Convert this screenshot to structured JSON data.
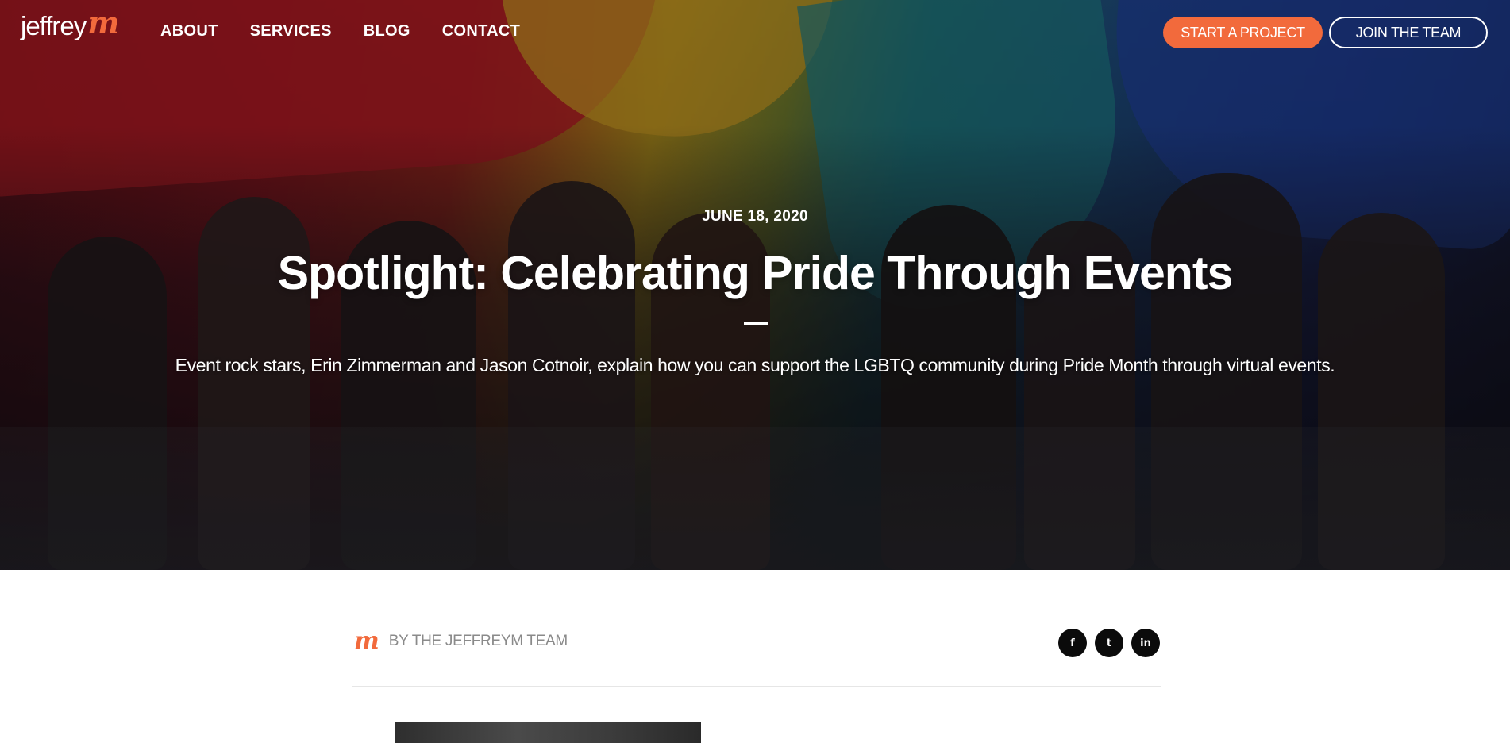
{
  "brand": {
    "logo_text": "jeffrey",
    "logo_mark": "m",
    "accent_color": "#f26a3c"
  },
  "nav": {
    "items": [
      {
        "label": "ABOUT"
      },
      {
        "label": "SERVICES"
      },
      {
        "label": "BLOG"
      },
      {
        "label": "CONTACT"
      }
    ],
    "start_project_label": "START A PROJECT",
    "join_team_label": "JOIN THE TEAM"
  },
  "hero": {
    "date": "JUNE 18, 2020",
    "title": "Spotlight: Celebrating Pride Through Events",
    "subtitle": "Event rock stars, Erin Zimmerman and Jason Cotnoir, explain how you can support the LGBTQ community during Pride Month through virtual events."
  },
  "byline": {
    "author_mark": "m",
    "author_label": "BY THE JEFFREYM TEAM"
  },
  "share": {
    "icons": [
      "facebook-icon",
      "twitter-icon",
      "linkedin-icon"
    ],
    "glyphs": {
      "facebook": "f",
      "twitter": "t",
      "linkedin": "in"
    }
  }
}
